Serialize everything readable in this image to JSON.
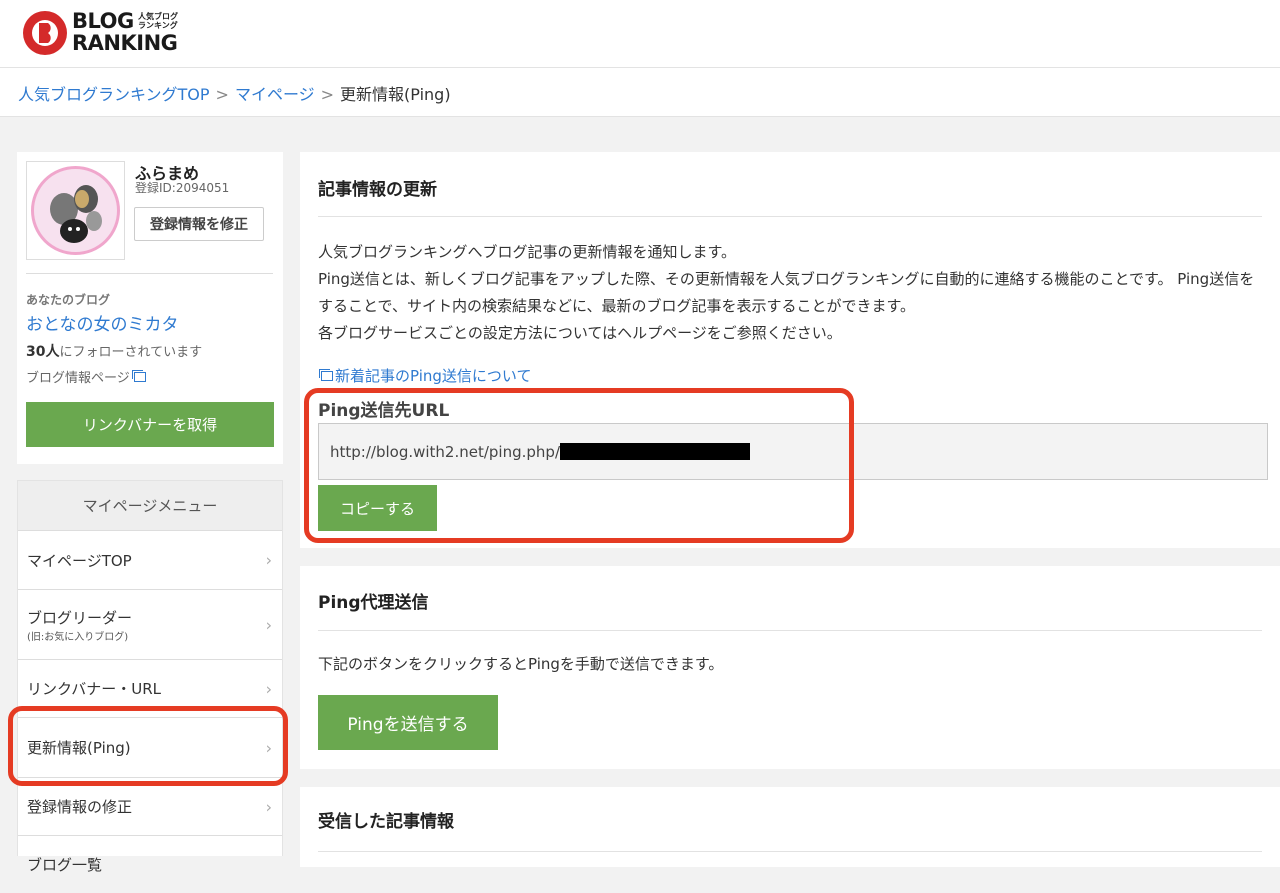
{
  "header": {
    "logo_line1": "BLOG",
    "logo_line2": "RANKING",
    "logo_sub_line1": "人気ブログ",
    "logo_sub_line2": "ランキング"
  },
  "breadcrumb": {
    "items": [
      "人気ブログランキングTOP",
      "マイページ",
      "更新情報(Ping)"
    ],
    "separator": ">"
  },
  "profile": {
    "name": "ふらまめ",
    "id_text": "登録ID:2094051",
    "edit_button": "登録情報を修正",
    "your_blog_label": "あなたのブログ",
    "blog_name": "おとなの女のミカタ",
    "followers_count": "30人",
    "followers_suffix": "にフォローされています",
    "blog_info_link": "ブログ情報ページ",
    "banner_button": "リンクバナーを取得"
  },
  "menu": {
    "title": "マイページメニュー",
    "items": [
      {
        "label": "マイページTOP",
        "sub": ""
      },
      {
        "label": "ブログリーダー",
        "sub": "(旧:お気に入りブログ)"
      },
      {
        "label": "リンクバナー・URL",
        "sub": ""
      },
      {
        "label": "更新情報(Ping)",
        "sub": ""
      },
      {
        "label": "登録情報の修正",
        "sub": ""
      },
      {
        "label": "ブログ一覧",
        "sub": ""
      }
    ],
    "chevron": "›"
  },
  "article_update": {
    "title": "記事情報の更新",
    "desc_line1": "人気ブログランキングへブログ記事の更新情報を通知します。",
    "desc_line2": "Ping送信とは、新しくブログ記事をアップした際、その更新情報を人気ブログランキングに自動的に連絡する機能のことです。 Ping送信をすることで、サイト内の検索結果などに、最新のブログ記事を表示することができます。",
    "desc_line3": "各ブログサービスごとの設定方法についてはヘルプページをご参照ください。",
    "help_link": "新着記事のPing送信について",
    "url_label": "Ping送信先URL",
    "url_value": "http://blog.with2.net/ping.php/",
    "copy_button": "コピーする"
  },
  "ping_proxy": {
    "title": "Ping代理送信",
    "description": "下記のボタンをクリックするとPingを手動で送信できます。",
    "send_button": "Pingを送信する"
  },
  "received": {
    "title": "受信した記事情報"
  },
  "colors": {
    "accent_green": "#6aa84f",
    "link_blue": "#2f7ad0",
    "highlight_red": "#e53b23"
  }
}
